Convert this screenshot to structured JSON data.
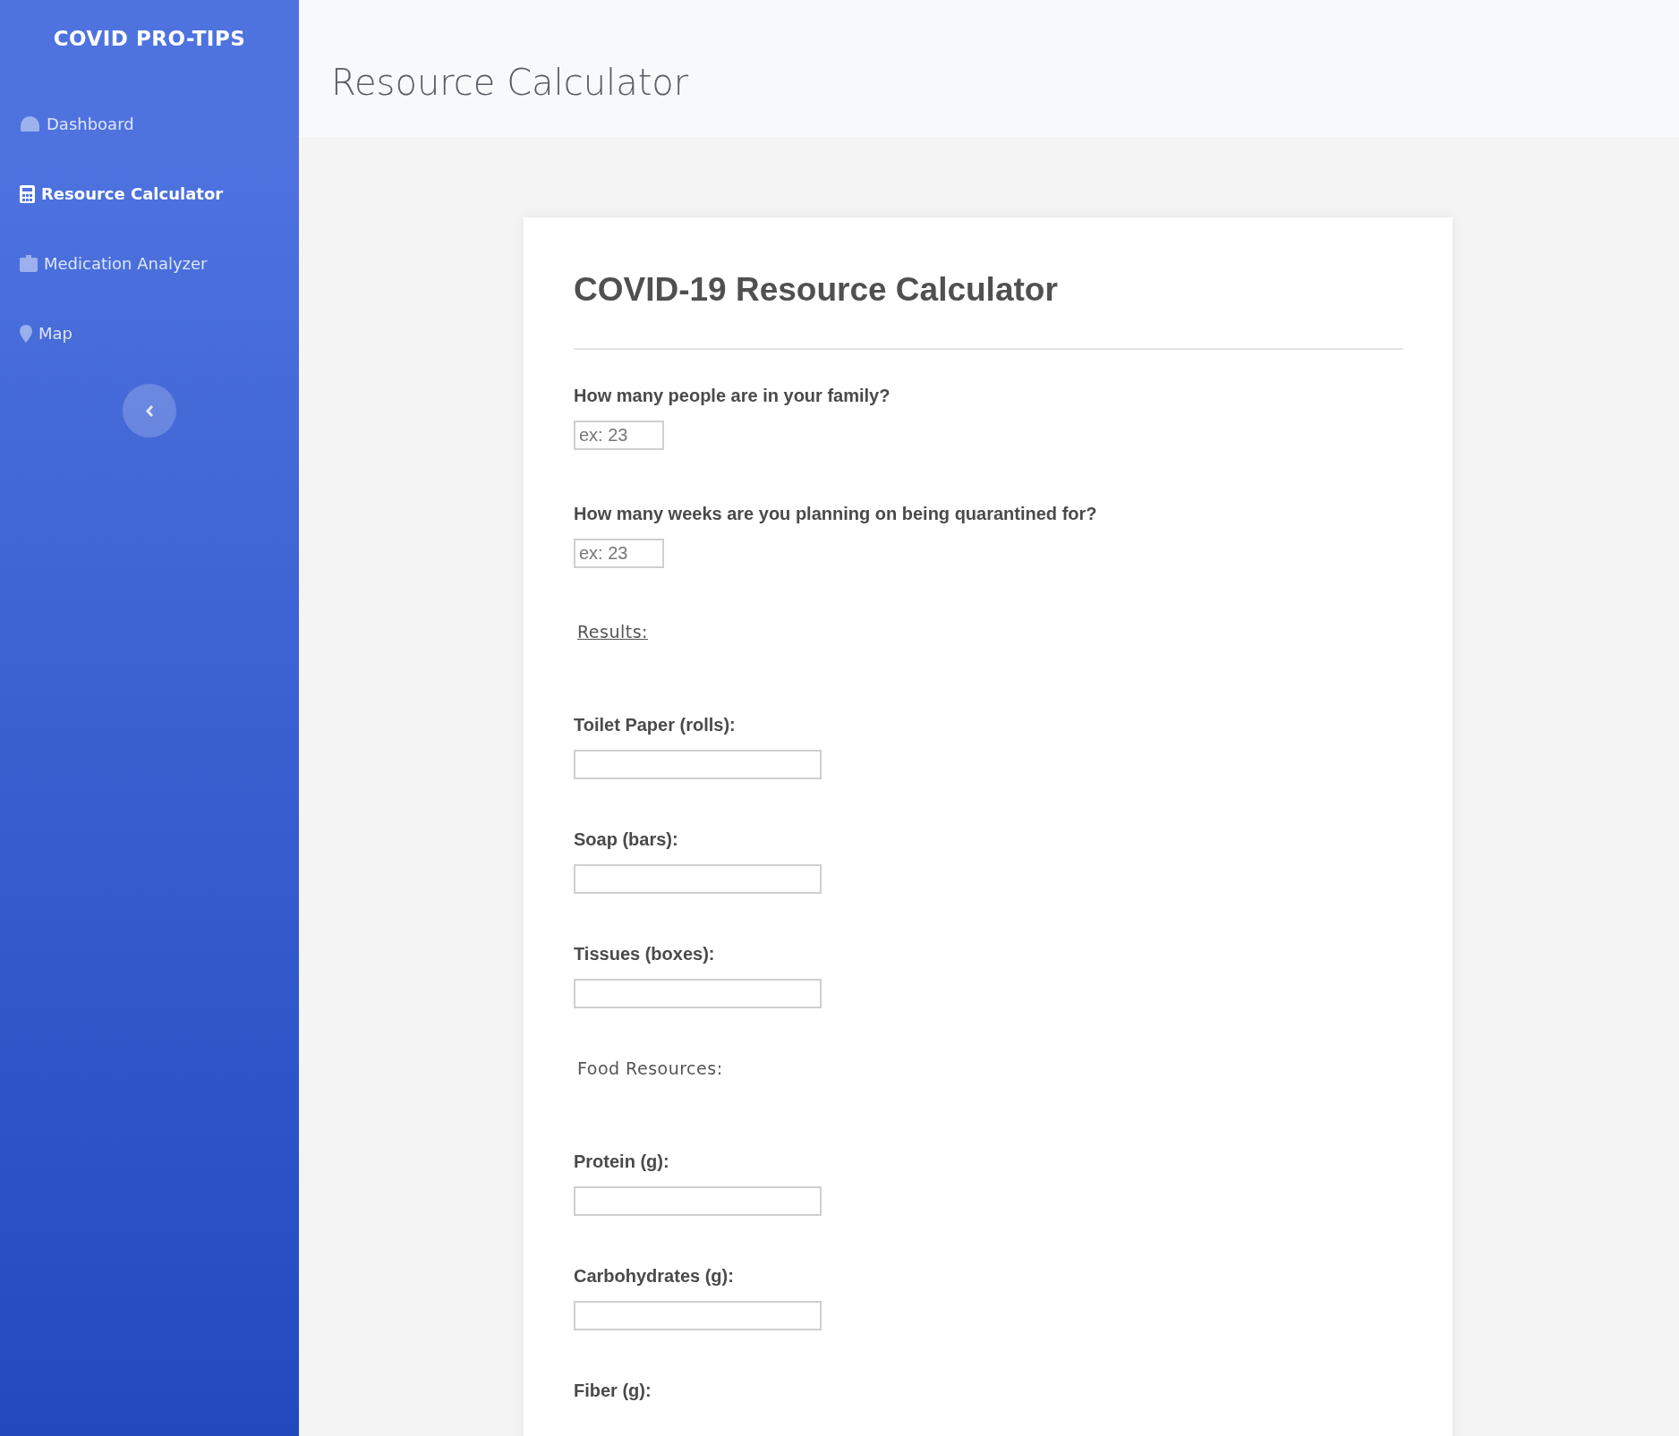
{
  "sidebar": {
    "brand": "COVID PRO-TIPS",
    "items": [
      {
        "label": "Dashboard",
        "selected": false
      },
      {
        "label": "Resource Calculator",
        "selected": true
      },
      {
        "label": "Medication Analyzer",
        "selected": false
      },
      {
        "label": "Map",
        "selected": false
      }
    ]
  },
  "header": {
    "title": "Resource Calculator"
  },
  "card": {
    "title": "COVID-19 Resource Calculator",
    "questions": [
      {
        "label": "How many people are in your family?",
        "placeholder": "ex: 23"
      },
      {
        "label": "How many weeks are you planning on being quarantined for?",
        "placeholder": "ex: 23"
      }
    ],
    "sections": [
      {
        "heading": "Results:",
        "underlined": true,
        "fields": [
          {
            "label": "Toilet Paper (rolls):"
          },
          {
            "label": "Soap (bars):"
          },
          {
            "label": "Tissues (boxes):"
          }
        ]
      },
      {
        "heading": "Food Resources:",
        "underlined": false,
        "fields": [
          {
            "label": "Protein (g):"
          },
          {
            "label": "Carbohydrates (g):"
          },
          {
            "label": "Fiber (g):"
          }
        ]
      }
    ]
  }
}
